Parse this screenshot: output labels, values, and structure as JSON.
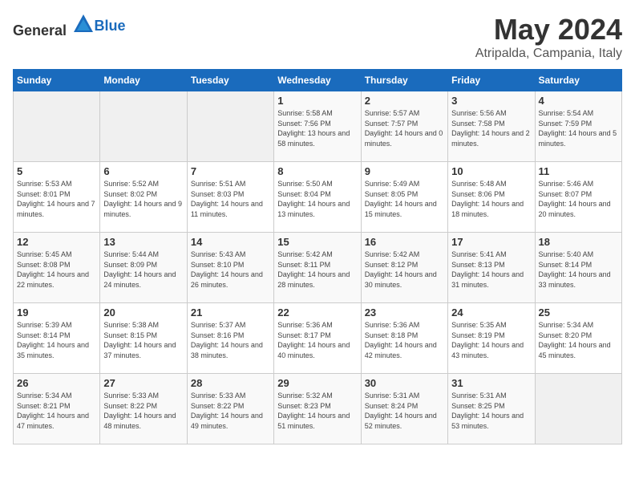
{
  "header": {
    "logo_general": "General",
    "logo_blue": "Blue",
    "title": "May 2024",
    "subtitle": "Atripalda, Campania, Italy"
  },
  "weekdays": [
    "Sunday",
    "Monday",
    "Tuesday",
    "Wednesday",
    "Thursday",
    "Friday",
    "Saturday"
  ],
  "weeks": [
    [
      {
        "day": "",
        "sunrise": "",
        "sunset": "",
        "daylight": ""
      },
      {
        "day": "",
        "sunrise": "",
        "sunset": "",
        "daylight": ""
      },
      {
        "day": "",
        "sunrise": "",
        "sunset": "",
        "daylight": ""
      },
      {
        "day": "1",
        "sunrise": "Sunrise: 5:58 AM",
        "sunset": "Sunset: 7:56 PM",
        "daylight": "Daylight: 13 hours and 58 minutes."
      },
      {
        "day": "2",
        "sunrise": "Sunrise: 5:57 AM",
        "sunset": "Sunset: 7:57 PM",
        "daylight": "Daylight: 14 hours and 0 minutes."
      },
      {
        "day": "3",
        "sunrise": "Sunrise: 5:56 AM",
        "sunset": "Sunset: 7:58 PM",
        "daylight": "Daylight: 14 hours and 2 minutes."
      },
      {
        "day": "4",
        "sunrise": "Sunrise: 5:54 AM",
        "sunset": "Sunset: 7:59 PM",
        "daylight": "Daylight: 14 hours and 5 minutes."
      }
    ],
    [
      {
        "day": "5",
        "sunrise": "Sunrise: 5:53 AM",
        "sunset": "Sunset: 8:01 PM",
        "daylight": "Daylight: 14 hours and 7 minutes."
      },
      {
        "day": "6",
        "sunrise": "Sunrise: 5:52 AM",
        "sunset": "Sunset: 8:02 PM",
        "daylight": "Daylight: 14 hours and 9 minutes."
      },
      {
        "day": "7",
        "sunrise": "Sunrise: 5:51 AM",
        "sunset": "Sunset: 8:03 PM",
        "daylight": "Daylight: 14 hours and 11 minutes."
      },
      {
        "day": "8",
        "sunrise": "Sunrise: 5:50 AM",
        "sunset": "Sunset: 8:04 PM",
        "daylight": "Daylight: 14 hours and 13 minutes."
      },
      {
        "day": "9",
        "sunrise": "Sunrise: 5:49 AM",
        "sunset": "Sunset: 8:05 PM",
        "daylight": "Daylight: 14 hours and 15 minutes."
      },
      {
        "day": "10",
        "sunrise": "Sunrise: 5:48 AM",
        "sunset": "Sunset: 8:06 PM",
        "daylight": "Daylight: 14 hours and 18 minutes."
      },
      {
        "day": "11",
        "sunrise": "Sunrise: 5:46 AM",
        "sunset": "Sunset: 8:07 PM",
        "daylight": "Daylight: 14 hours and 20 minutes."
      }
    ],
    [
      {
        "day": "12",
        "sunrise": "Sunrise: 5:45 AM",
        "sunset": "Sunset: 8:08 PM",
        "daylight": "Daylight: 14 hours and 22 minutes."
      },
      {
        "day": "13",
        "sunrise": "Sunrise: 5:44 AM",
        "sunset": "Sunset: 8:09 PM",
        "daylight": "Daylight: 14 hours and 24 minutes."
      },
      {
        "day": "14",
        "sunrise": "Sunrise: 5:43 AM",
        "sunset": "Sunset: 8:10 PM",
        "daylight": "Daylight: 14 hours and 26 minutes."
      },
      {
        "day": "15",
        "sunrise": "Sunrise: 5:42 AM",
        "sunset": "Sunset: 8:11 PM",
        "daylight": "Daylight: 14 hours and 28 minutes."
      },
      {
        "day": "16",
        "sunrise": "Sunrise: 5:42 AM",
        "sunset": "Sunset: 8:12 PM",
        "daylight": "Daylight: 14 hours and 30 minutes."
      },
      {
        "day": "17",
        "sunrise": "Sunrise: 5:41 AM",
        "sunset": "Sunset: 8:13 PM",
        "daylight": "Daylight: 14 hours and 31 minutes."
      },
      {
        "day": "18",
        "sunrise": "Sunrise: 5:40 AM",
        "sunset": "Sunset: 8:14 PM",
        "daylight": "Daylight: 14 hours and 33 minutes."
      }
    ],
    [
      {
        "day": "19",
        "sunrise": "Sunrise: 5:39 AM",
        "sunset": "Sunset: 8:14 PM",
        "daylight": "Daylight: 14 hours and 35 minutes."
      },
      {
        "day": "20",
        "sunrise": "Sunrise: 5:38 AM",
        "sunset": "Sunset: 8:15 PM",
        "daylight": "Daylight: 14 hours and 37 minutes."
      },
      {
        "day": "21",
        "sunrise": "Sunrise: 5:37 AM",
        "sunset": "Sunset: 8:16 PM",
        "daylight": "Daylight: 14 hours and 38 minutes."
      },
      {
        "day": "22",
        "sunrise": "Sunrise: 5:36 AM",
        "sunset": "Sunset: 8:17 PM",
        "daylight": "Daylight: 14 hours and 40 minutes."
      },
      {
        "day": "23",
        "sunrise": "Sunrise: 5:36 AM",
        "sunset": "Sunset: 8:18 PM",
        "daylight": "Daylight: 14 hours and 42 minutes."
      },
      {
        "day": "24",
        "sunrise": "Sunrise: 5:35 AM",
        "sunset": "Sunset: 8:19 PM",
        "daylight": "Daylight: 14 hours and 43 minutes."
      },
      {
        "day": "25",
        "sunrise": "Sunrise: 5:34 AM",
        "sunset": "Sunset: 8:20 PM",
        "daylight": "Daylight: 14 hours and 45 minutes."
      }
    ],
    [
      {
        "day": "26",
        "sunrise": "Sunrise: 5:34 AM",
        "sunset": "Sunset: 8:21 PM",
        "daylight": "Daylight: 14 hours and 47 minutes."
      },
      {
        "day": "27",
        "sunrise": "Sunrise: 5:33 AM",
        "sunset": "Sunset: 8:22 PM",
        "daylight": "Daylight: 14 hours and 48 minutes."
      },
      {
        "day": "28",
        "sunrise": "Sunrise: 5:33 AM",
        "sunset": "Sunset: 8:22 PM",
        "daylight": "Daylight: 14 hours and 49 minutes."
      },
      {
        "day": "29",
        "sunrise": "Sunrise: 5:32 AM",
        "sunset": "Sunset: 8:23 PM",
        "daylight": "Daylight: 14 hours and 51 minutes."
      },
      {
        "day": "30",
        "sunrise": "Sunrise: 5:31 AM",
        "sunset": "Sunset: 8:24 PM",
        "daylight": "Daylight: 14 hours and 52 minutes."
      },
      {
        "day": "31",
        "sunrise": "Sunrise: 5:31 AM",
        "sunset": "Sunset: 8:25 PM",
        "daylight": "Daylight: 14 hours and 53 minutes."
      },
      {
        "day": "",
        "sunrise": "",
        "sunset": "",
        "daylight": ""
      }
    ]
  ]
}
